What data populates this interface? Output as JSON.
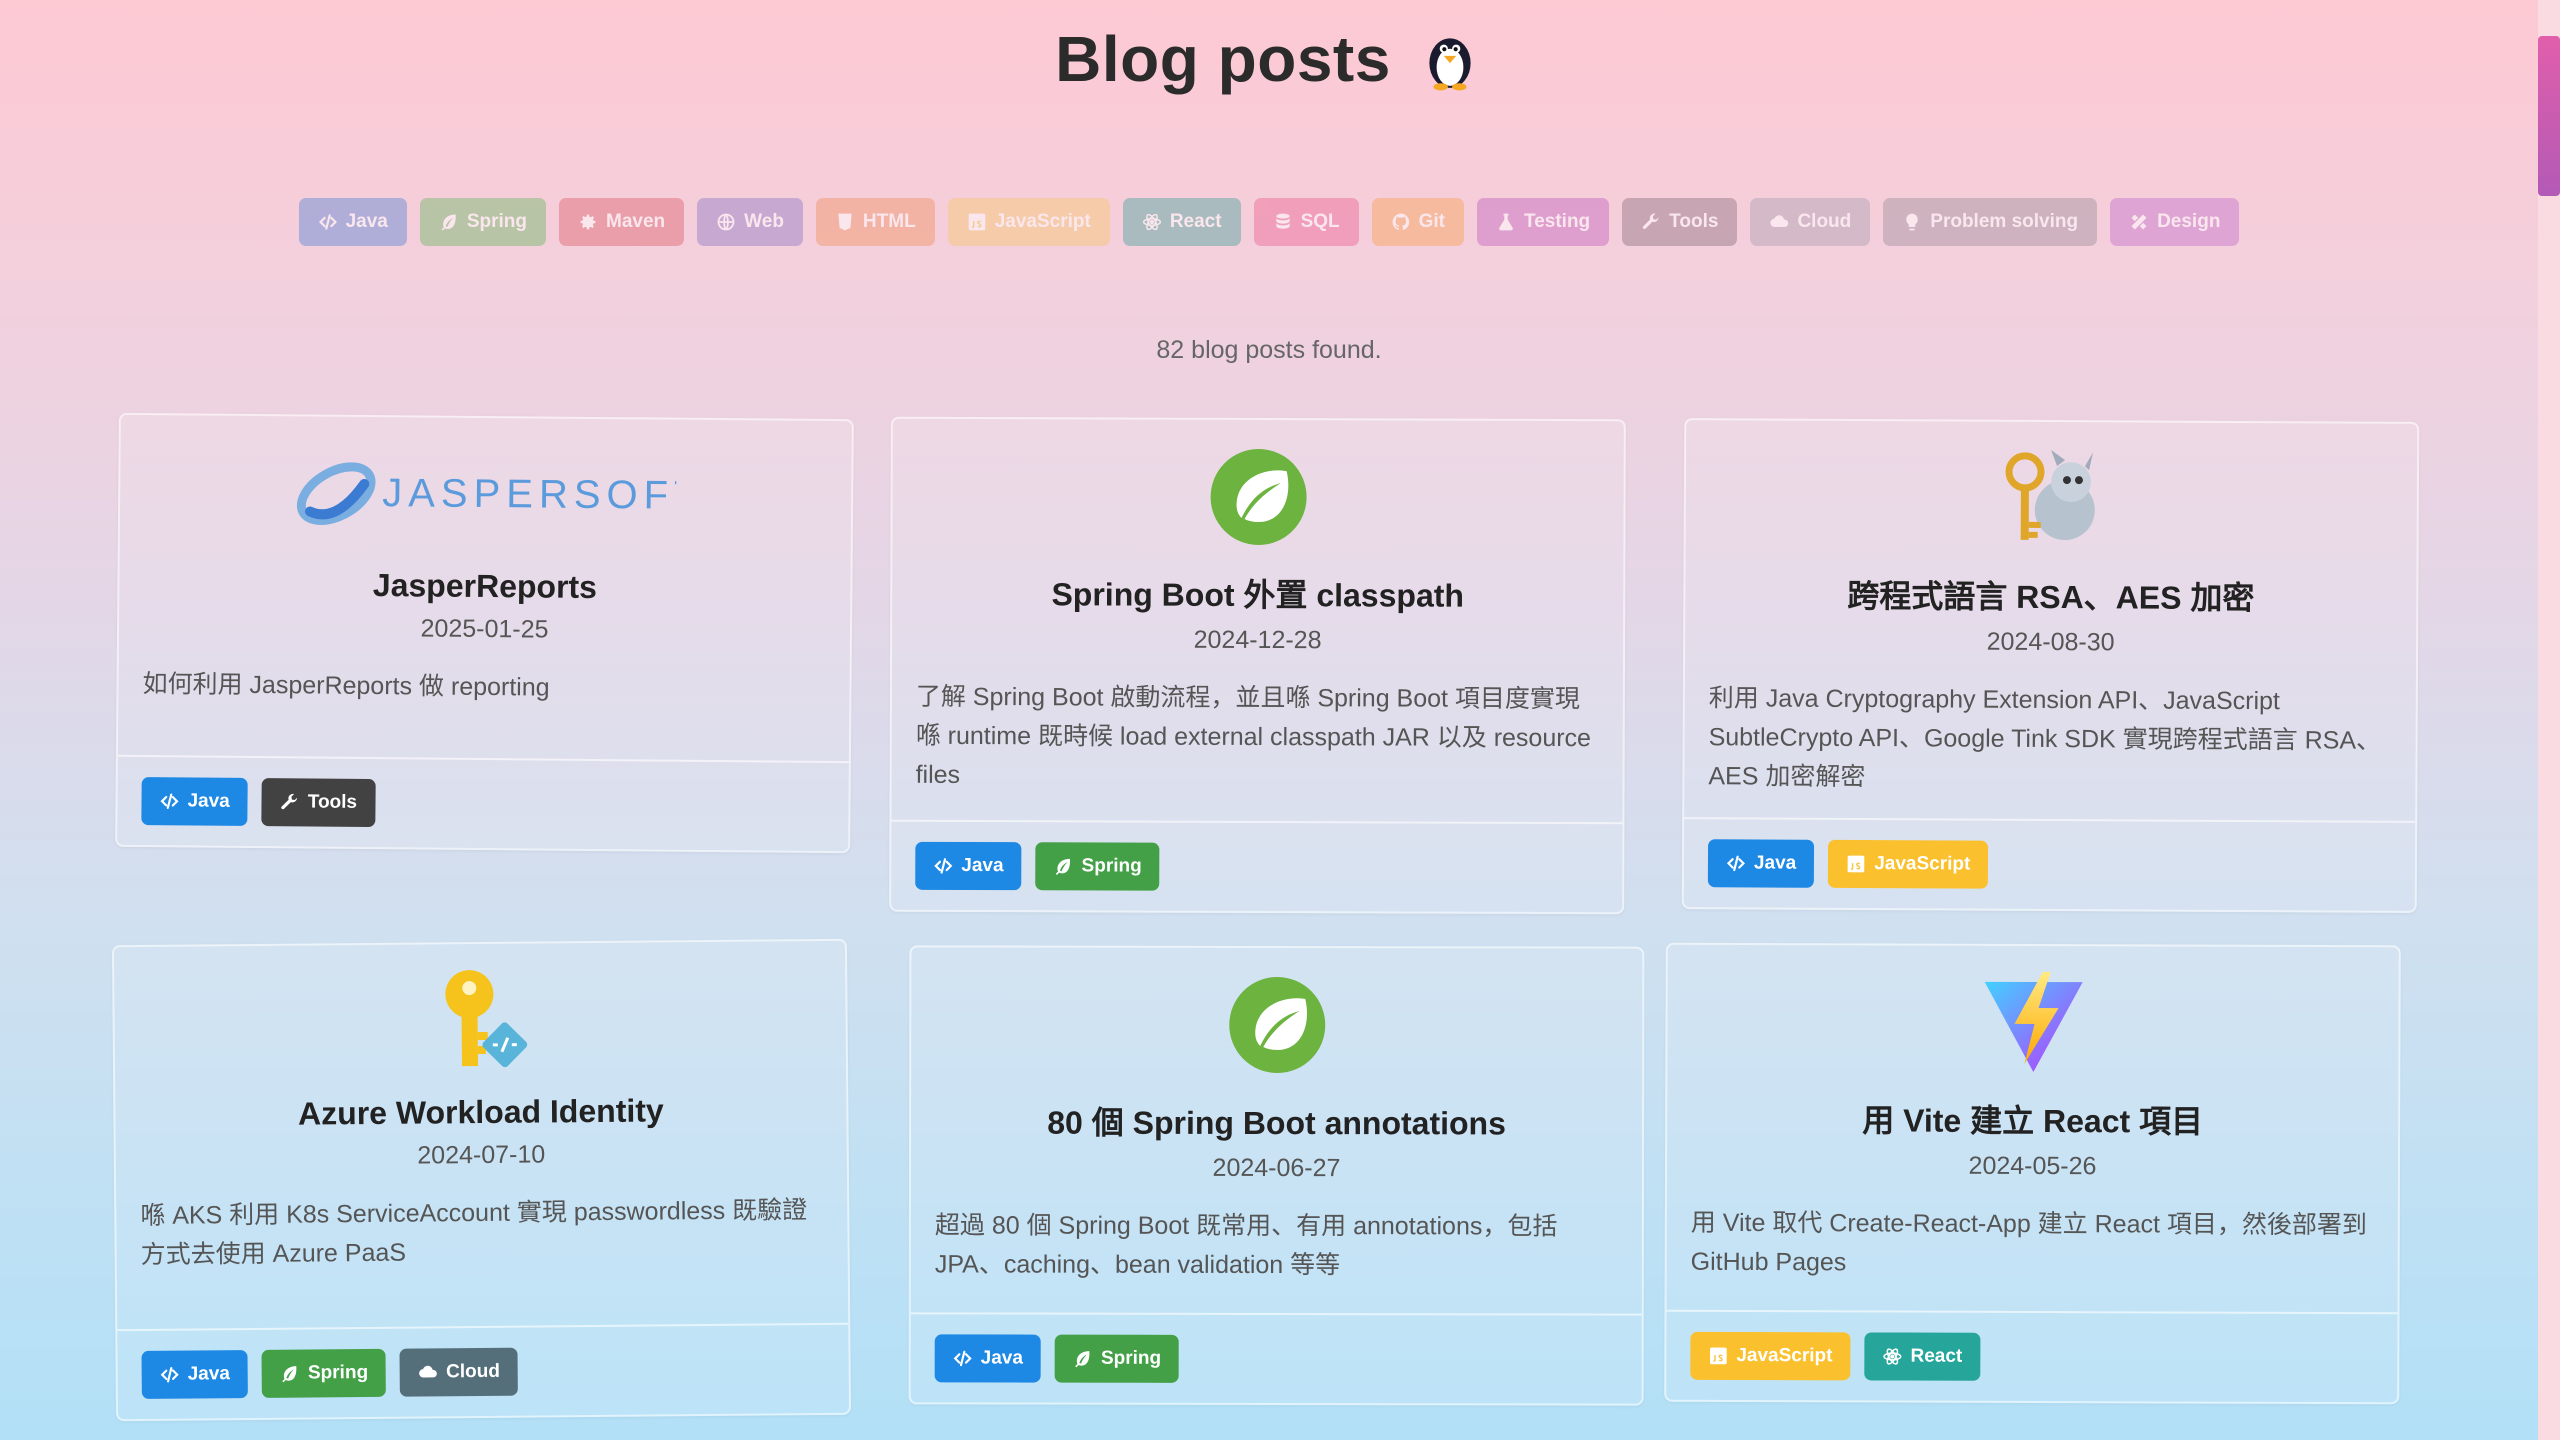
{
  "page_title": "Blog posts",
  "filters": [
    {
      "label": "Java",
      "icon": "code-icon",
      "color": "#6c8fd6"
    },
    {
      "label": "Spring",
      "icon": "leaf-icon",
      "color": "#7dbb73"
    },
    {
      "label": "Maven",
      "icon": "gear-icon",
      "color": "#e0707a"
    },
    {
      "label": "Web",
      "icon": "globe-icon",
      "color": "#9a84c8"
    },
    {
      "label": "HTML",
      "icon": "html5-icon",
      "color": "#f29a6f"
    },
    {
      "label": "JavaScript",
      "icon": "js-icon",
      "color": "#f5c97a"
    },
    {
      "label": "React",
      "icon": "atom-icon",
      "color": "#5fa9a3"
    },
    {
      "label": "SQL",
      "icon": "database-icon",
      "color": "#ec6f9c"
    },
    {
      "label": "Git",
      "icon": "github-icon",
      "color": "#f7a863"
    },
    {
      "label": "Testing",
      "icon": "flask-icon",
      "color": "#c86fc2"
    },
    {
      "label": "Tools",
      "icon": "wrench-icon",
      "color": "#9a7d8c"
    },
    {
      "label": "Cloud",
      "icon": "cloud-icon",
      "color": "#b4a6b8"
    },
    {
      "label": "Problem solving",
      "icon": "lightbulb-icon",
      "color": "#a898a4"
    },
    {
      "label": "Design",
      "icon": "pencil-ruler-icon",
      "color": "#c87cce"
    }
  ],
  "results_text": "82 blog posts found.",
  "cards": [
    {
      "image": "jaspersoft-logo",
      "logo_text": "JASPERSOFT",
      "title": "JasperReports",
      "date": "2025-01-25",
      "description": "如何利用 JasperReports 做 reporting",
      "tags": [
        {
          "label": "Java",
          "icon": "code-icon",
          "color": "#1e88e5"
        },
        {
          "label": "Tools",
          "icon": "wrench-icon",
          "color": "#424242"
        }
      ]
    },
    {
      "image": "spring-logo",
      "title": "Spring Boot 外置 classpath",
      "date": "2024-12-28",
      "description": "了解 Spring Boot 啟動流程，並且喺 Spring Boot 項目度實現喺 runtime 既時候 load external classpath JAR 以及 resource files",
      "tags": [
        {
          "label": "Java",
          "icon": "code-icon",
          "color": "#1e88e5"
        },
        {
          "label": "Spring",
          "icon": "leaf-icon",
          "color": "#43a047"
        }
      ]
    },
    {
      "image": "key-dragon-illustration",
      "title": "跨程式語言 RSA、AES 加密",
      "date": "2024-08-30",
      "description": "利用 Java Cryptography Extension API、JavaScript SubtleCrypto API、Google Tink SDK 實現跨程式語言 RSA、AES 加密解密",
      "tags": [
        {
          "label": "Java",
          "icon": "code-icon",
          "color": "#1e88e5"
        },
        {
          "label": "JavaScript",
          "icon": "js-icon",
          "color": "#fbc02d"
        }
      ]
    },
    {
      "image": "azure-key-icon",
      "title": "Azure Workload Identity",
      "date": "2024-07-10",
      "description": "喺 AKS 利用 K8s ServiceAccount 實現 passwordless 既驗證方式去使用 Azure PaaS",
      "tags": [
        {
          "label": "Java",
          "icon": "code-icon",
          "color": "#1e88e5"
        },
        {
          "label": "Spring",
          "icon": "leaf-icon",
          "color": "#43a047"
        },
        {
          "label": "Cloud",
          "icon": "cloud-icon",
          "color": "#546e7a"
        }
      ]
    },
    {
      "image": "spring-logo",
      "title": "80 個 Spring Boot annotations",
      "date": "2024-06-27",
      "description": "超過 80 個 Spring Boot 既常用、有用 annotations，包括 JPA、caching、bean validation 等等",
      "tags": [
        {
          "label": "Java",
          "icon": "code-icon",
          "color": "#1e88e5"
        },
        {
          "label": "Spring",
          "icon": "leaf-icon",
          "color": "#43a047"
        }
      ]
    },
    {
      "image": "vite-logo",
      "title": "用 Vite 建立 React 項目",
      "date": "2024-05-26",
      "description": "用 Vite 取代 Create-React-App 建立 React 項目，然後部署到 GitHub Pages",
      "tags": [
        {
          "label": "JavaScript",
          "icon": "js-icon",
          "color": "#fbc02d"
        },
        {
          "label": "React",
          "icon": "atom-icon",
          "color": "#26a69a"
        }
      ]
    }
  ]
}
